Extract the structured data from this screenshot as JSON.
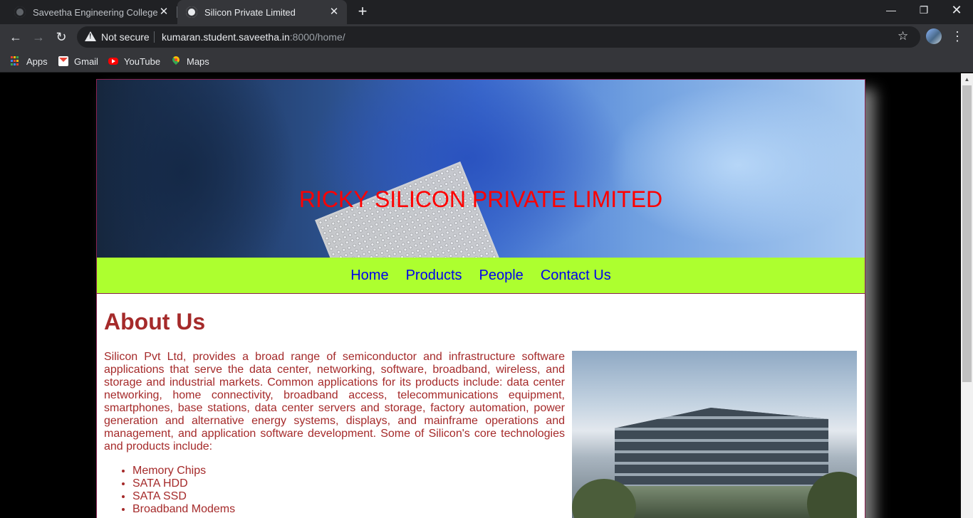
{
  "browser": {
    "tabs": [
      {
        "title": "Saveetha Engineering College",
        "active": false
      },
      {
        "title": "Silicon Private Limited",
        "active": true
      }
    ],
    "address": {
      "security_label": "Not secure",
      "url_host": "kumaran.student.saveetha.in",
      "url_rest": ":8000/home/"
    },
    "bookmarks": [
      {
        "label": "Apps",
        "icon": "apps-grid-icon"
      },
      {
        "label": "Gmail",
        "icon": "gmail-icon"
      },
      {
        "label": "YouTube",
        "icon": "youtube-icon"
      },
      {
        "label": "Maps",
        "icon": "maps-icon"
      }
    ],
    "glyphs": {
      "close": "✕",
      "new_tab": "+",
      "minimize": "—",
      "maximize": "❐",
      "window_close": "✕",
      "back": "←",
      "forward": "→",
      "reload": "↻",
      "star": "☆",
      "menu": "⋮",
      "scroll_up": "▲"
    }
  },
  "site": {
    "banner_title": "RICKY SILICON PRIVATE LIMITED",
    "nav": [
      "Home",
      "Products",
      "People",
      "Contact Us"
    ],
    "about": {
      "heading": "About Us",
      "paragraph": "Silicon Pvt Ltd, provides a broad range of semiconductor and infrastructure software applications that serve the data center, networking, software, broadband, wireless, and storage and industrial markets. Common applications for its products include: data center networking, home connectivity, broadband access, telecommunications equipment, smartphones, base stations, data center servers and storage, factory automation, power generation and alternative energy systems, displays, and mainframe operations and management, and application software development. Some of Silicon's core technologies and products include:",
      "products": [
        "Memory Chips",
        "SATA HDD",
        "SATA SSD",
        "Broadband Modems"
      ]
    }
  }
}
